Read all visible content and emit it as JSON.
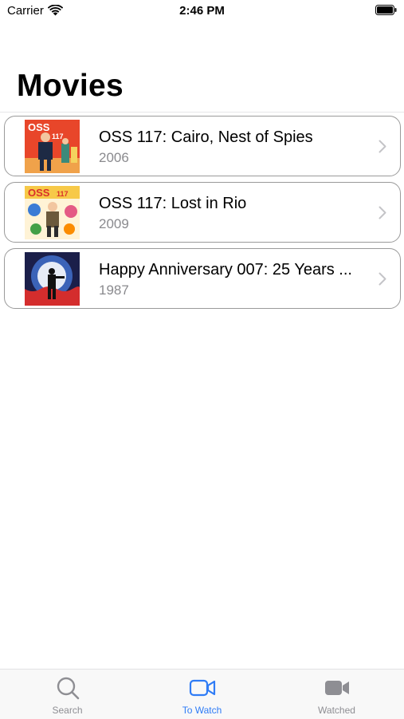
{
  "status_bar": {
    "carrier": "Carrier",
    "time": "2:46 PM"
  },
  "header": {
    "title": "Movies"
  },
  "movies": [
    {
      "title": "OSS 117: Cairo, Nest of Spies",
      "year": "2006",
      "poster_icon": "oss117-cairo-poster"
    },
    {
      "title": "OSS 117: Lost in Rio",
      "year": "2009",
      "poster_icon": "oss117-rio-poster"
    },
    {
      "title": "Happy Anniversary 007: 25 Years ...",
      "year": "1987",
      "poster_icon": "007-anniversary-poster"
    }
  ],
  "tab_bar": {
    "tabs": [
      {
        "label": "Search",
        "icon": "search-icon",
        "active": false
      },
      {
        "label": "To Watch",
        "icon": "video-outline-icon",
        "active": true
      },
      {
        "label": "Watched",
        "icon": "video-filled-icon",
        "active": false
      }
    ]
  },
  "colors": {
    "accent": "#2f7cf6",
    "inactive": "#8e8e93",
    "secondary_text": "#8a8a8e"
  }
}
